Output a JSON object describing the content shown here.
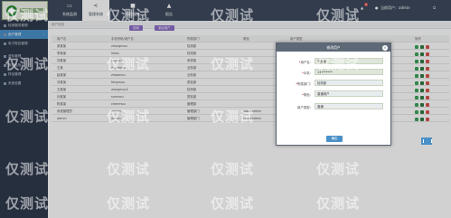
{
  "header": {
    "nav": [
      {
        "icon": "monitor-icon",
        "label": "系统监测"
      },
      {
        "icon": "share-icon",
        "label": "管理系统"
      },
      {
        "icon": "flag-icon",
        "label": "报检服务"
      },
      {
        "icon": "upload-icon",
        "label": "报告"
      }
    ],
    "active_index": 1,
    "user": "当前用户：admin",
    "badge": "9"
  },
  "sidebar": {
    "items": [
      {
        "label": "检测服务管理",
        "active": false
      },
      {
        "label": "用户管理",
        "active": true
      },
      {
        "label": "电子报告管理",
        "active": false
      },
      {
        "label": "资料管理",
        "active": false
      },
      {
        "label": "报告检测",
        "active": false
      },
      {
        "label": "样品管理",
        "active": false
      },
      {
        "label": "系统设置",
        "active": false
      }
    ]
  },
  "toolbar": {
    "search_label": "查询",
    "add_label": "添加用户",
    "crumb": "用户信息"
  },
  "table": {
    "columns": [
      "用户名",
      "手机号码/用户名",
      "所属部门",
      "角色",
      "用户类型",
      "操作"
    ],
    "rows": [
      [
        "张某某",
        "zhangmou",
        "检测部",
        "",
        "普通",
        ""
      ],
      [
        "李某某",
        "limou",
        "检测部",
        "",
        "管理员",
        ""
      ],
      [
        "刘某某",
        "liumou",
        "采样部",
        "",
        "普通",
        ""
      ],
      [
        "王某",
        "wangmou",
        "业务部",
        "",
        "普通",
        ""
      ],
      [
        "赵某某",
        "zhaomou",
        "业务部",
        "",
        "普通",
        ""
      ],
      [
        "冯某某",
        "fengmou",
        "质检部",
        "",
        "普通",
        ""
      ],
      [
        "王某某",
        "wangmou2",
        "检测部",
        "",
        "普通",
        ""
      ],
      [
        "孙某某",
        "sunmou",
        "质检部",
        "",
        "普通",
        ""
      ],
      [
        "陈某某",
        "chenmou",
        "管理部",
        "",
        "普通",
        ""
      ],
      [
        "系统管理员",
        "admin",
        "管理部门",
        "superadmin",
        ""
      ],
      [
        "admin",
        "admin",
        "管理部门",
        "superadmin",
        ""
      ]
    ]
  },
  "modal": {
    "title": "修改用户",
    "fields": [
      {
        "label": "用户名：",
        "value": "张某某",
        "required": true
      },
      {
        "label": "手机：",
        "value": "137******",
        "required": true
      },
      {
        "label": "所属部门：",
        "value": "检测部",
        "required": true
      },
      {
        "label": "角色：",
        "value": "普通用户",
        "required": true
      },
      {
        "label": "用户类型：",
        "value": "普通",
        "required": false
      }
    ],
    "ok_label": "确定"
  },
  "watermark": "仅测试"
}
